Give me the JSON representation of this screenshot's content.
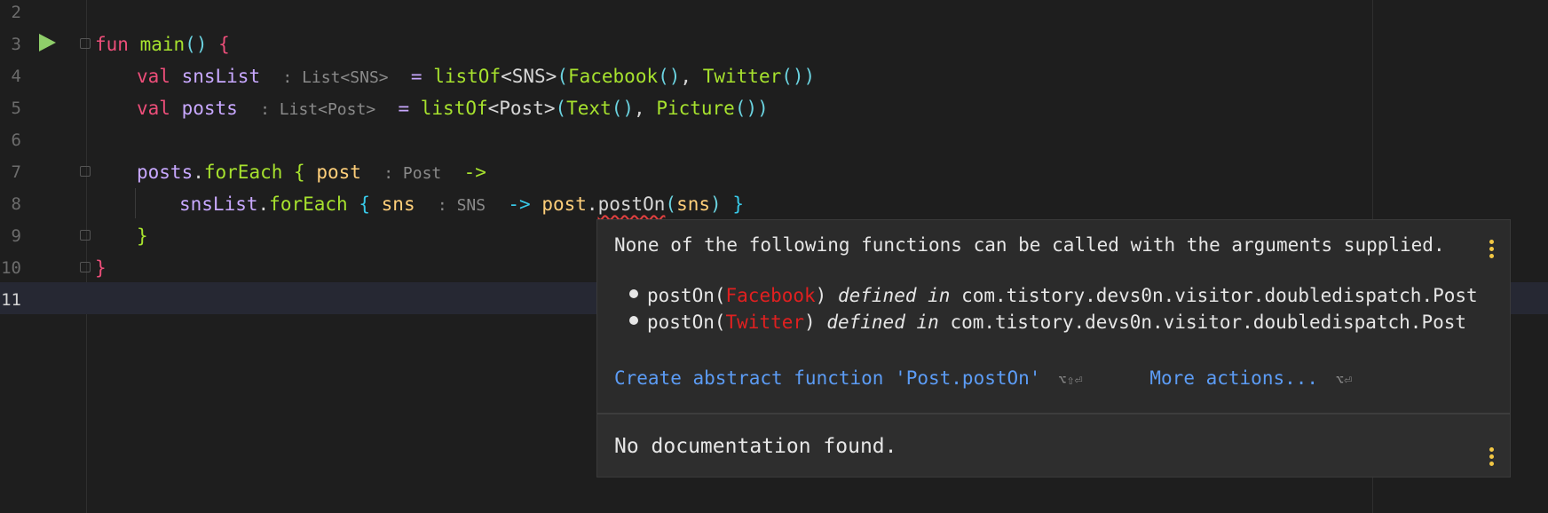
{
  "editor": {
    "line_numbers": [
      "2",
      "3",
      "4",
      "5",
      "6",
      "7",
      "8",
      "9",
      "10",
      "11"
    ],
    "current_line": "11",
    "lines": {
      "l3": {
        "kw": "fun",
        "name": "main",
        "parens": "()",
        "brace": "{"
      },
      "l4": {
        "kw": "val",
        "name": "snsList",
        "hint": ": List<SNS>",
        "eq": "=",
        "call": "listOf",
        "type": "<SNS>",
        "args_open": "(",
        "a1": "Facebook",
        "a1p": "()",
        "comma": ",",
        "a2": "Twitter",
        "a2p": "()",
        "args_close": ")"
      },
      "l5": {
        "kw": "val",
        "name": "posts",
        "hint": ": List<Post>",
        "eq": "=",
        "call": "listOf",
        "type": "<Post>",
        "args_open": "(",
        "a1": "Text",
        "a1p": "()",
        "comma": ",",
        "a2": "Picture",
        "a2p": "()",
        "args_close": ")"
      },
      "l7": {
        "recv": "posts",
        "dot": ".",
        "call": "forEach",
        "brace": "{",
        "param": "post",
        "hint": ": Post",
        "arrow": "->"
      },
      "l8": {
        "recv": "snsList",
        "dot": ".",
        "call": "forEach",
        "brace": "{",
        "param": "sns",
        "hint": ": SNS",
        "arrow": "->",
        "target": "post",
        "dot2": ".",
        "method": "postOn",
        "po": "(",
        "arg": "sns",
        "pc": ")",
        "close": "}"
      },
      "l9": {
        "brace": "}"
      },
      "l10": {
        "brace": "}"
      }
    }
  },
  "popup": {
    "message": "None of the following functions can be called with the arguments supplied.",
    "items": [
      {
        "fn": "postOn(",
        "arg": "Facebook",
        "close": ")",
        "defined": "defined in",
        "pkg": "com.tistory.devs0n.visitor.doubledispatch.Post"
      },
      {
        "fn": "postOn(",
        "arg": "Twitter",
        "close": ")",
        "defined": "defined in",
        "pkg": "com.tistory.devs0n.visitor.doubledispatch.Post"
      }
    ],
    "action_primary": "Create abstract function 'Post.postOn'",
    "action_primary_shortcut": "⌥⇧⏎",
    "action_more": "More actions...",
    "action_more_shortcut": "⌥⏎",
    "documentation": "No documentation found."
  },
  "colors": {
    "keyword": "#ec4e79",
    "function": "#a7e22e",
    "link": "#5c9cf5",
    "error": "#e02020",
    "run": "#8fce6a"
  }
}
